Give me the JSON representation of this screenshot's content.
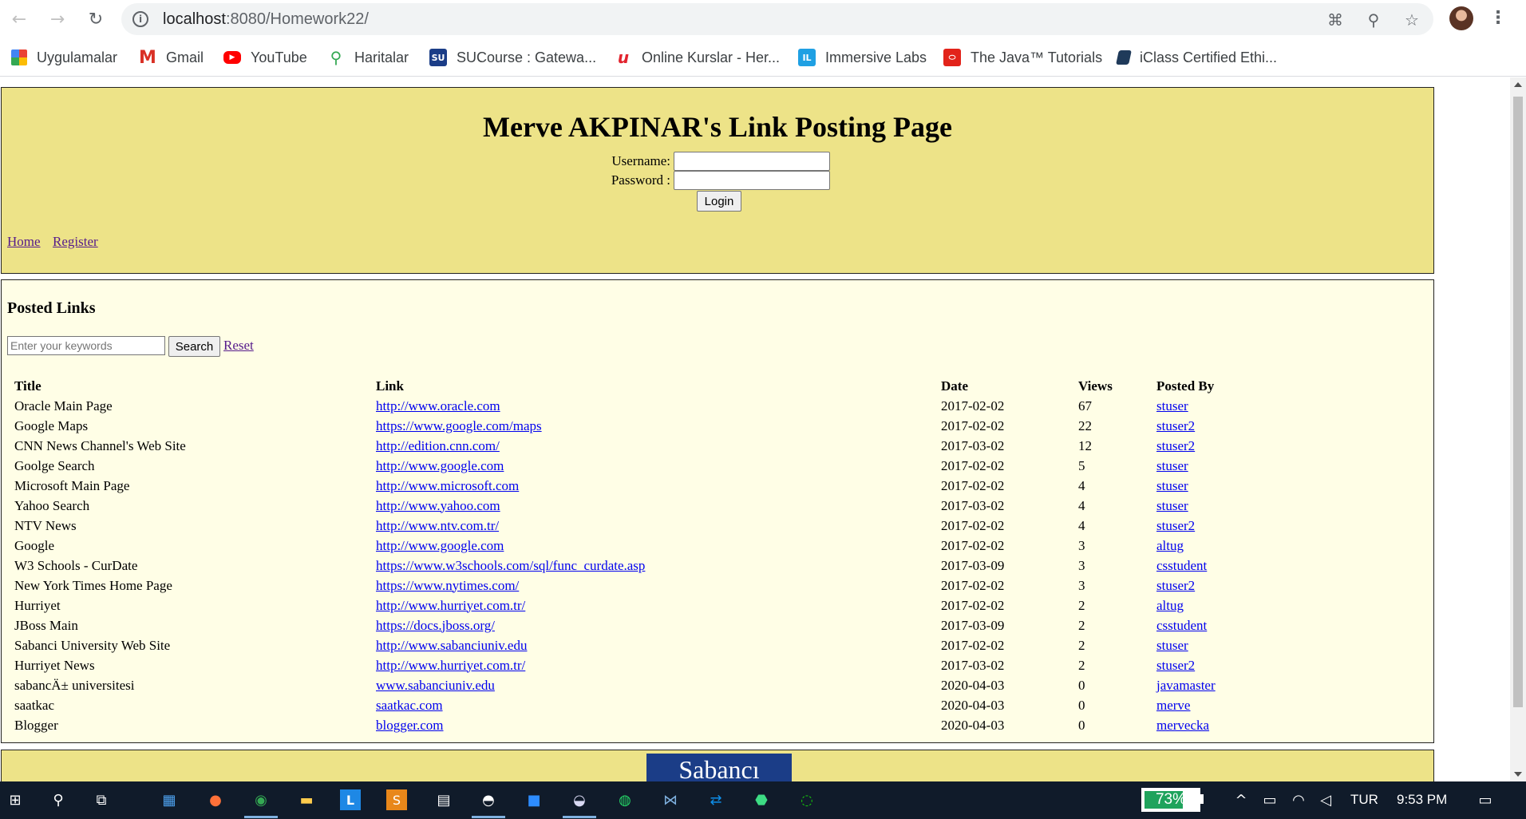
{
  "browser": {
    "url_host": "localhost",
    "url_rest": ":8080/Homework22/",
    "bookmarks": [
      {
        "label": "Uygulamalar",
        "icon": "apps-grid-icon"
      },
      {
        "label": "Gmail",
        "icon": "gmail-icon"
      },
      {
        "label": "YouTube",
        "icon": "youtube-icon"
      },
      {
        "label": "Haritalar",
        "icon": "maps-icon"
      },
      {
        "label": "SUCourse : Gatewa...",
        "icon": "sucourse-icon"
      },
      {
        "label": "Online Kurslar - Her...",
        "icon": "udemy-icon"
      },
      {
        "label": "Immersive Labs",
        "icon": "immersive-labs-icon"
      },
      {
        "label": "The Java™ Tutorials",
        "icon": "oracle-icon"
      },
      {
        "label": "iClass Certified Ethi...",
        "icon": "book-icon"
      }
    ]
  },
  "header": {
    "title": "Merve AKPINAR's Link Posting Page",
    "username_label": "Username:",
    "password_label": "Password :",
    "username_value": "",
    "password_value": "",
    "login_label": "Login",
    "nav": {
      "home": "Home",
      "register": "Register"
    }
  },
  "posted": {
    "title": "Posted Links",
    "search_placeholder": "Enter your keywords",
    "search_value": "",
    "search_label": "Search",
    "reset_label": "Reset",
    "columns": {
      "title": "Title",
      "link": "Link",
      "date": "Date",
      "views": "Views",
      "posted_by": "Posted By"
    },
    "rows": [
      {
        "title": "Oracle Main Page",
        "link": "http://www.oracle.com",
        "date": "2017-02-02",
        "views": "67",
        "user": "stuser"
      },
      {
        "title": "Google Maps",
        "link": "https://www.google.com/maps",
        "date": "2017-02-02",
        "views": "22",
        "user": "stuser2"
      },
      {
        "title": "CNN News Channel's Web Site",
        "link": "http://edition.cnn.com/",
        "date": "2017-03-02",
        "views": "12",
        "user": "stuser2"
      },
      {
        "title": "Goolge Search",
        "link": "http://www.google.com",
        "date": "2017-02-02",
        "views": "5",
        "user": "stuser"
      },
      {
        "title": "Microsoft Main Page",
        "link": "http://www.microsoft.com",
        "date": "2017-02-02",
        "views": "4",
        "user": "stuser"
      },
      {
        "title": "Yahoo Search",
        "link": "http://www.yahoo.com",
        "date": "2017-03-02",
        "views": "4",
        "user": "stuser"
      },
      {
        "title": "NTV News",
        "link": "http://www.ntv.com.tr/",
        "date": "2017-02-02",
        "views": "4",
        "user": "stuser2"
      },
      {
        "title": "Google",
        "link": "http://www.google.com",
        "date": "2017-02-02",
        "views": "3",
        "user": "altug"
      },
      {
        "title": "W3 Schools - CurDate",
        "link": "https://www.w3schools.com/sql/func_curdate.asp",
        "date": "2017-03-09",
        "views": "3",
        "user": "csstudent"
      },
      {
        "title": "New York Times Home Page",
        "link": "https://www.nytimes.com/",
        "date": "2017-02-02",
        "views": "3",
        "user": "stuser2"
      },
      {
        "title": "Hurriyet",
        "link": "http://www.hurriyet.com.tr/",
        "date": "2017-02-02",
        "views": "2",
        "user": "altug"
      },
      {
        "title": "JBoss Main",
        "link": "https://docs.jboss.org/",
        "date": "2017-03-09",
        "views": "2",
        "user": "csstudent"
      },
      {
        "title": "Sabanci University Web Site",
        "link": "http://www.sabanciuniv.edu",
        "date": "2017-02-02",
        "views": "2",
        "user": "stuser"
      },
      {
        "title": "Hurriyet News",
        "link": "http://www.hurriyet.com.tr/",
        "date": "2017-03-02",
        "views": "2",
        "user": "stuser2"
      },
      {
        "title": "sabancÄ± universitesi",
        "link": "www.sabanciuniv.edu",
        "date": "2020-04-03",
        "views": "0",
        "user": "javamaster"
      },
      {
        "title": "saatkac",
        "link": "saatkac.com",
        "date": "2020-04-03",
        "views": "0",
        "user": "merve"
      },
      {
        "title": "Blogger",
        "link": "blogger.com",
        "date": "2020-04-03",
        "views": "0",
        "user": "mervecka"
      }
    ]
  },
  "footer": {
    "logo_text": "Sabancı"
  },
  "taskbar": {
    "battery_percent": 73,
    "battery_text": "73%",
    "language": "TUR",
    "time": "9:53 PM"
  },
  "colors": {
    "header_bg": "#ede388",
    "panel_bg": "#fffee6",
    "link": "#0000ee",
    "visited": "#551a8b",
    "logo_bg": "#1b3d87"
  }
}
